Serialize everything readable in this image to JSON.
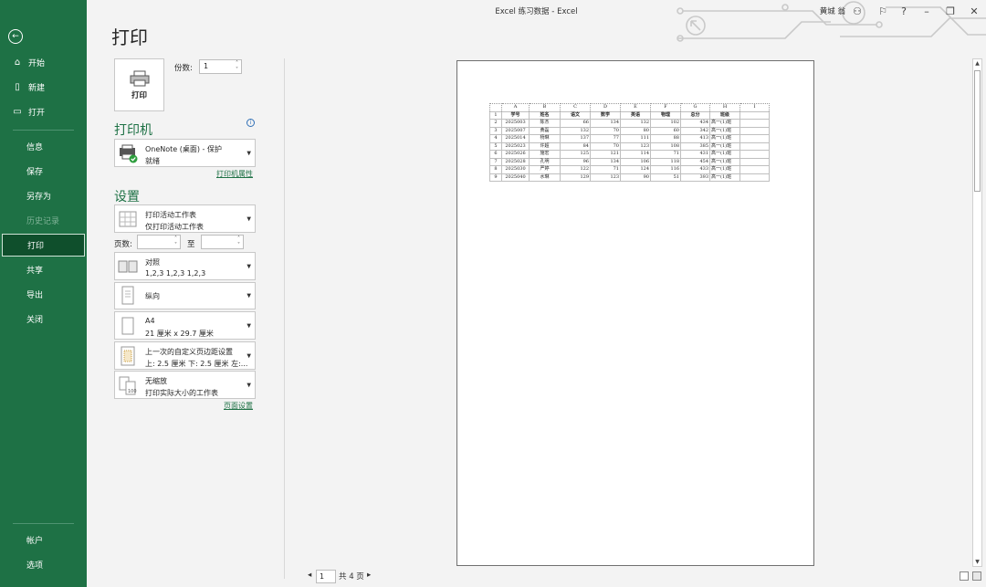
{
  "window": {
    "title": "Excel  练习数据  -  Excel",
    "user": "黄城 翁"
  },
  "titlebar": {
    "help": "?",
    "minimize": "–",
    "restore": "❐",
    "close": "✕",
    "share_icon": "⚐",
    "person_icon": "⚇"
  },
  "nav": {
    "back": "←",
    "items": [
      {
        "label": "开始",
        "icon": "⌂"
      },
      {
        "label": "新建",
        "icon": "🗋"
      },
      {
        "label": "打开",
        "icon": "🗁"
      }
    ],
    "sub": [
      "信息",
      "保存",
      "另存为",
      "历史记录",
      "打印",
      "共享",
      "导出",
      "关闭"
    ],
    "bottom": [
      "帐户",
      "选项"
    ]
  },
  "print": {
    "title": "打印",
    "button": "打印",
    "copies_label": "份数:",
    "copies_value": "1",
    "printer_header": "打印机",
    "printer_name": "OneNote (桌面) - 保护",
    "printer_status": "就绪",
    "printer_props": "打印机属性",
    "settings_header": "设置",
    "what": {
      "l1": "打印活动工作表",
      "l2": "仅打印活动工作表"
    },
    "pages_label": "页数:",
    "to_label": "至",
    "collate": {
      "l1": "对照",
      "l2": "1,2,3    1,2,3    1,2,3"
    },
    "orientation": {
      "l1": "纵向"
    },
    "paper": {
      "l1": "A4",
      "l2": "21 厘米 x 29.7 厘米"
    },
    "margins": {
      "l1": "上一次的自定义页边距设置",
      "l2": "上: 2.5 厘米 下: 2.5 厘米 左:..."
    },
    "scaling": {
      "l1": "无缩放",
      "l2": "打印实际大小的工作表"
    },
    "page_setup": "页面设置"
  },
  "preview": {
    "columns": [
      "",
      "A",
      "B",
      "C",
      "D",
      "E",
      "F",
      "G",
      "H",
      "I"
    ],
    "header_row": {
      "n": "1",
      "cells": [
        "学号",
        "姓名",
        "语文",
        "数学",
        "英语",
        "物理",
        "总分",
        "班级"
      ]
    },
    "rows": [
      {
        "n": "2",
        "cells": [
          "2025003",
          "陈杰",
          "66",
          "134",
          "132",
          "102",
          "434",
          "高一(1)班"
        ]
      },
      {
        "n": "3",
        "cells": [
          "2025007",
          "黄磊",
          "132",
          "70",
          "80",
          "60",
          "342",
          "高一(1)班"
        ]
      },
      {
        "n": "4",
        "cells": [
          "2025014",
          "杨琳",
          "137",
          "77",
          "111",
          "88",
          "413",
          "高一(1)班"
        ]
      },
      {
        "n": "5",
        "cells": [
          "2025023",
          "许超",
          "84",
          "70",
          "123",
          "108",
          "385",
          "高一(1)班"
        ]
      },
      {
        "n": "6",
        "cells": [
          "2025026",
          "施宏",
          "125",
          "121",
          "114",
          "71",
          "431",
          "高一(1)班"
        ]
      },
      {
        "n": "7",
        "cells": [
          "2025028",
          "孔明",
          "96",
          "134",
          "106",
          "118",
          "454",
          "高一(1)班"
        ]
      },
      {
        "n": "8",
        "cells": [
          "2025030",
          "严婷",
          "122",
          "71",
          "124",
          "116",
          "433",
          "高一(1)班"
        ]
      },
      {
        "n": "9",
        "cells": [
          "2025040",
          "水琳",
          "129",
          "123",
          "90",
          "51",
          "393",
          "高一(1)班"
        ]
      }
    ],
    "pager": {
      "prev": "◂",
      "current": "1",
      "total": "共 4 页",
      "next": "▸"
    }
  }
}
